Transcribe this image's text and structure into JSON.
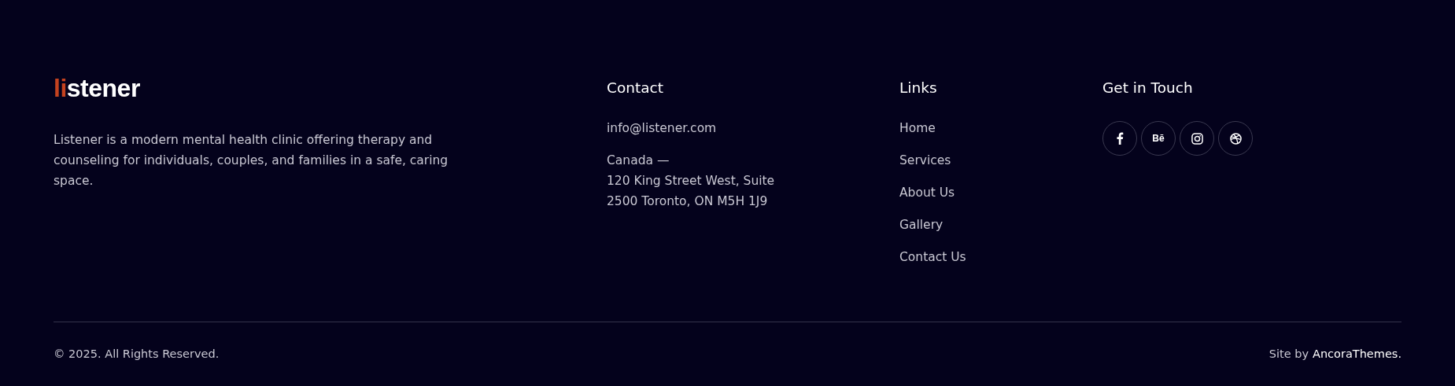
{
  "brand": {
    "logo": {
      "accent": "li",
      "rest": "stener"
    },
    "description": "Listener is a modern mental health clinic offering therapy and counseling for individuals, couples, and families in a safe, caring space."
  },
  "contact": {
    "title": "Contact",
    "email": "info@listener.com",
    "address": [
      "Canada —",
      "120 King Street West, Suite",
      "2500 Toronto, ON M5H 1J9"
    ]
  },
  "links": {
    "title": "Links",
    "items": [
      "Home",
      "Services",
      "About Us",
      "Gallery",
      "Contact Us"
    ]
  },
  "social": {
    "title": "Get in Touch",
    "items": [
      {
        "kind": "facebook"
      },
      {
        "kind": "text",
        "glyph": "Bē"
      },
      {
        "kind": "instagram"
      },
      {
        "kind": "dribbble"
      }
    ]
  },
  "bottom": {
    "copyright": "© 2025. All Rights Reserved.",
    "credit_prefix": "Site by",
    "credit_link": "AncoraThemes."
  }
}
